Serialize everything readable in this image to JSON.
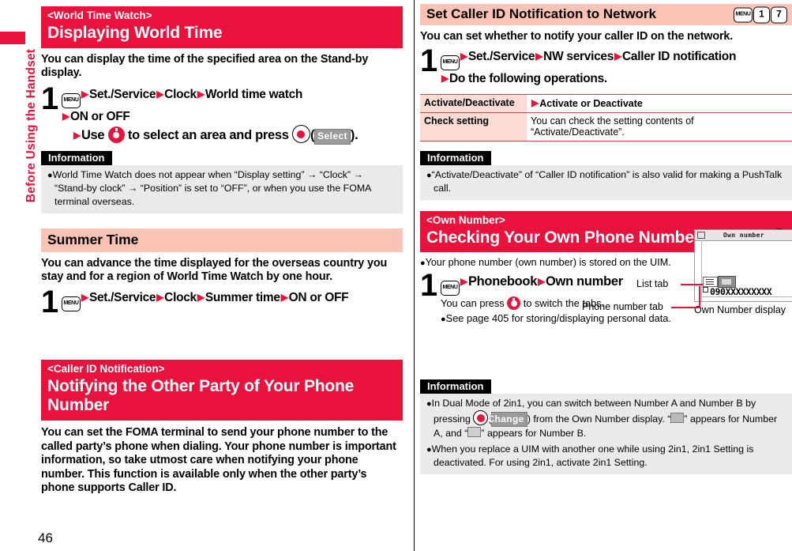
{
  "sidebar": {
    "tab_label": "Before Using the Handset",
    "tab_color": "#e8123c"
  },
  "page": {
    "number": "46"
  },
  "colors": {
    "red": "#e8123c",
    "pink_heading": "#fbc3b6",
    "table_key_bg": "#fbdcd5",
    "info_bg": "#eaeaea"
  },
  "left_column": {
    "section1": {
      "heading_sub": "<World Time Watch>",
      "heading_main": "Displaying World Time",
      "intro": "You can display the time of the specified area on the Stand-by display.",
      "step_number": "1",
      "step_line1_parts": {
        "key": "MENU",
        "item1": "Set./Service",
        "item2": "Clock",
        "item3": "World time watch"
      },
      "step_line2": "ON or OFF",
      "step_line3_pre": "Use",
      "step_line3_mid": "to select an area and press",
      "step_line3_soft": "Select",
      "step_line3_end": ").",
      "information": {
        "label": "Information",
        "items": [
          "World Time Watch does not appear when “Display setting” → “Clock” → “Stand-by clock” → “Position” is set to “OFF”, or when you use the FOMA terminal overseas."
        ]
      }
    },
    "section2": {
      "heading": "Summer Time",
      "intro": "You can advance the time displayed for the overseas country you stay and for a region of World Time Watch by one hour.",
      "step_number": "1",
      "step_parts": {
        "key": "MENU",
        "item1": "Set./Service",
        "item2": "Clock",
        "item3": "Summer time",
        "item4": "ON or OFF"
      }
    },
    "section3": {
      "heading_sub": "<Caller ID Notification>",
      "heading_main": "Notifying the Other Party of Your Phone Number",
      "body": "You can set the FOMA terminal to send your phone number to the called party’s phone when dialing. Your phone number is important information, so take utmost care when notifying your phone number. This function is available only when the other party’s phone supports Caller ID."
    }
  },
  "right_column": {
    "section1": {
      "heading": "Set Caller ID Notification to Network",
      "keys": [
        "MENU",
        "1",
        "7"
      ],
      "intro": "You can set whether to notify your caller ID on the network.",
      "step_number": "1",
      "step_parts": {
        "key": "MENU",
        "item1": "Set./Service",
        "item2": "NW services",
        "item3": "Caller ID notification"
      },
      "step_line2": "Do the following operations.",
      "table": {
        "rows": [
          {
            "key": "Activate/Deactivate",
            "value": "Activate or Deactivate",
            "has_arrow": true
          },
          {
            "key": "Check setting",
            "value": "You can check the setting contents of “Activate/Deactivate”.",
            "has_arrow": false
          }
        ]
      },
      "information": {
        "label": "Information",
        "items": [
          "“Activate/Deactivate” of “Caller ID notification” is also valid for making a PushTalk call."
        ]
      }
    },
    "section2": {
      "heading_sub": "<Own Number>",
      "heading_main": "Checking Your Own Phone Number",
      "keys": [
        "MENU",
        "O"
      ],
      "note": "Your phone number (own number) is stored on the UIM.",
      "step_number": "1",
      "step_parts": {
        "key": "MENU",
        "item1": "Phonebook",
        "item2": "Own number"
      },
      "step_sub1_pre": "You can press",
      "step_sub1_post": "to switch the tabs.",
      "step_sub2": "See page 405 for storing/displaying personal data.",
      "figure": {
        "screen_title": "Own number",
        "phone_number": "090XXXXXXXXX",
        "callout_list_tab": "List tab",
        "callout_phone_tab": "Phone number tab",
        "caption": "Own Number display"
      },
      "information": {
        "label": "Information",
        "items": [
          {
            "pre": "In Dual Mode of 2in1, you can switch between Number A and Number B by pressing",
            "soft": "Change",
            "mid": ") from the Own Number display. “",
            "mid2": "” appears for Number A, and “",
            "post": "” appears for Number B."
          },
          {
            "text": "When you replace a UIM with another one while using 2in1, 2in1 Setting is deactivated. For using 2in1, activate 2in1 Setting."
          }
        ]
      }
    }
  }
}
